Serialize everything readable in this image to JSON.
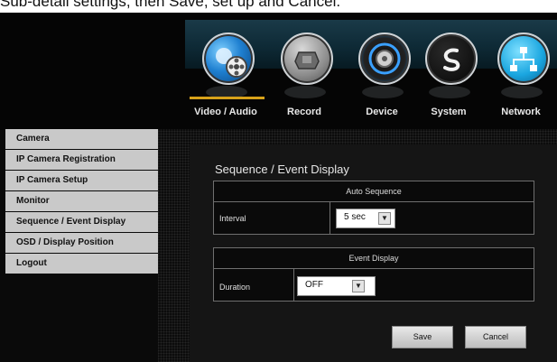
{
  "top_strip": {
    "text": "Sub-detail settings, then Save, set up and Cancel."
  },
  "nav": {
    "items": [
      {
        "label": "Video / Audio",
        "icon": "video-audio-icon",
        "active": true
      },
      {
        "label": "Record",
        "icon": "record-icon"
      },
      {
        "label": "Device",
        "icon": "device-icon"
      },
      {
        "label": "System",
        "icon": "system-icon"
      },
      {
        "label": "Network",
        "icon": "network-icon"
      }
    ],
    "active_color": "#d8a21a"
  },
  "sidebar": {
    "items": [
      {
        "label": "Camera"
      },
      {
        "label": "IP Camera Registration"
      },
      {
        "label": "IP Camera Setup"
      },
      {
        "label": "Monitor"
      },
      {
        "label": "Sequence / Event Display"
      },
      {
        "label": "OSD / Display Position"
      },
      {
        "label": "Logout"
      }
    ]
  },
  "main": {
    "title": "Sequence / Event Display",
    "auto_sequence": {
      "header": "Auto Sequence",
      "interval_label": "Interval",
      "interval_value": "5 sec"
    },
    "event_display": {
      "header": "Event Display",
      "duration_label": "Duration",
      "duration_value": "OFF"
    },
    "buttons": {
      "save": "Save",
      "cancel": "Cancel"
    }
  }
}
